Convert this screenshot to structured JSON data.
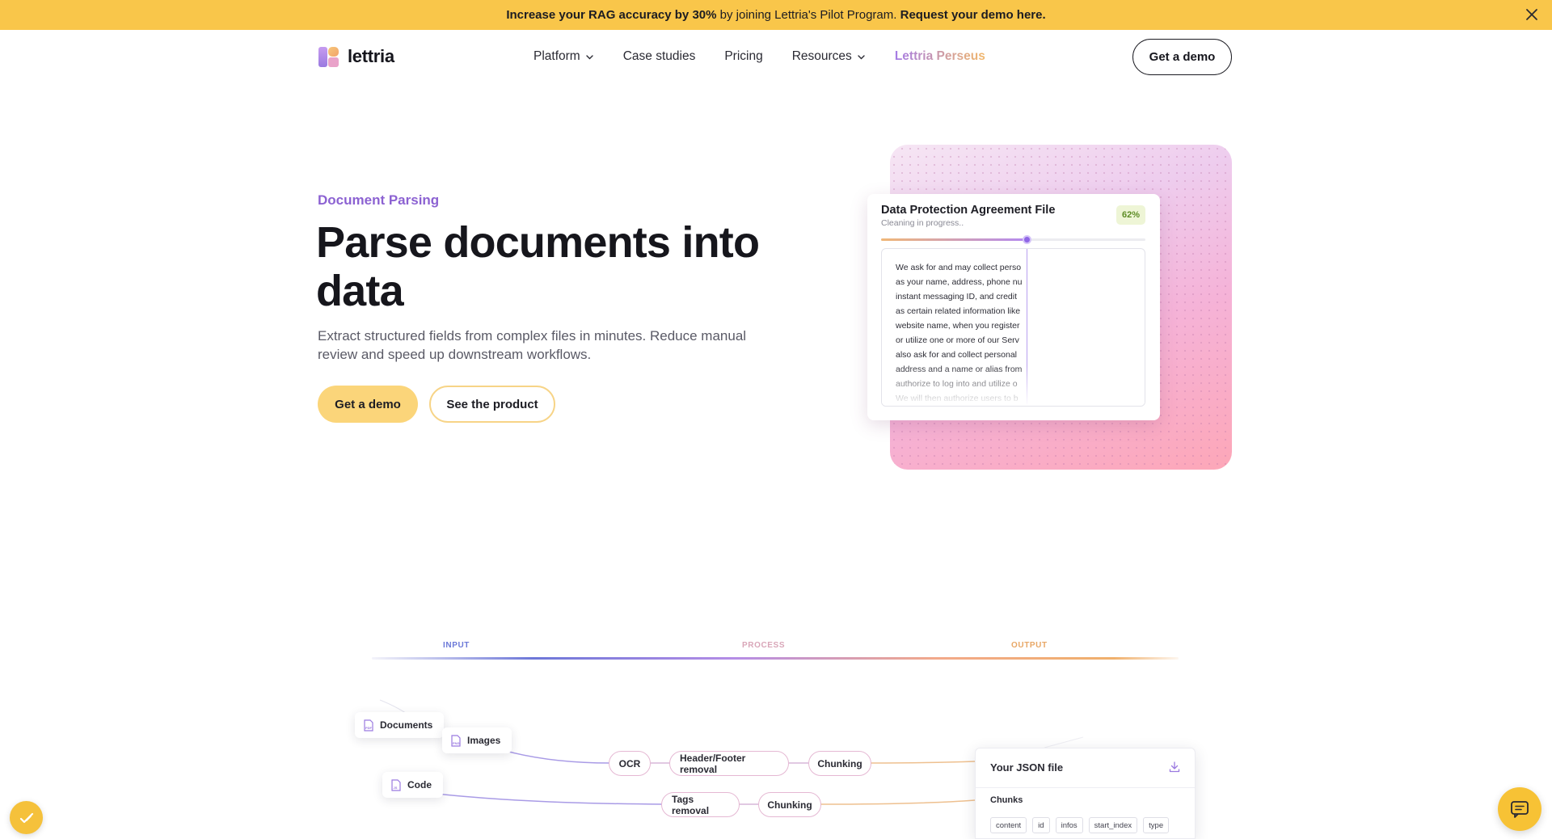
{
  "announcement": {
    "highlight": "Increase your RAG accuracy by 30%",
    "middle": "by joining Lettria's Pilot Program.",
    "cta": "Request your demo here."
  },
  "brand": {
    "name": "lettria"
  },
  "nav": {
    "items": [
      {
        "label": "Platform",
        "has_dropdown": true
      },
      {
        "label": "Case studies",
        "has_dropdown": false
      },
      {
        "label": "Pricing",
        "has_dropdown": false
      },
      {
        "label": "Resources",
        "has_dropdown": true
      },
      {
        "label": "Lettria Perseus",
        "has_dropdown": false
      }
    ],
    "cta": "Get a demo"
  },
  "hero": {
    "eyebrow": "Document Parsing",
    "title": "Parse documents into data",
    "subtitle": "Extract structured fields from complex files in minutes. Reduce manual review and speed up downstream workflows.",
    "primary_cta": "Get a demo",
    "secondary_cta": "See the product"
  },
  "preview_card": {
    "title": "Data Protection Agreement File",
    "status": "Cleaning in progress..",
    "badge": "62%",
    "progress": 0.55,
    "text_lines": [
      "We ask for and may collect perso",
      "as your name, address, phone nu",
      "instant messaging ID, and credit",
      "as certain related information like",
      "website name, when you register",
      "or utilize one or more of our Serv",
      "also ask for and collect personal",
      "address and a name or alias from",
      "authorize to log into and utilize o",
      "We will then authorize users to b"
    ]
  },
  "flow": {
    "stages": {
      "input": "INPUT",
      "process": "PROCESS",
      "output": "OUTPUT"
    },
    "sources": [
      "Documents",
      "Images",
      "Code"
    ],
    "row1": [
      "OCR",
      "Header/Footer removal",
      "Chunking"
    ],
    "row2": [
      "Tags removal",
      "Chunking"
    ],
    "output": {
      "title": "Your JSON file",
      "section": "Chunks",
      "fields": [
        "content",
        "id",
        "infos",
        "start_index",
        "type"
      ]
    }
  },
  "colors": {
    "banner": "#f9c64a",
    "accent_purple": "#8c62d2",
    "button_yellow": "#fbd57a",
    "badge_green": "#5d8c25"
  },
  "icons": {
    "close": "close-icon",
    "chevron": "chevron-down-icon",
    "download": "download-icon",
    "chat": "chat-icon",
    "document": "document-icon"
  }
}
